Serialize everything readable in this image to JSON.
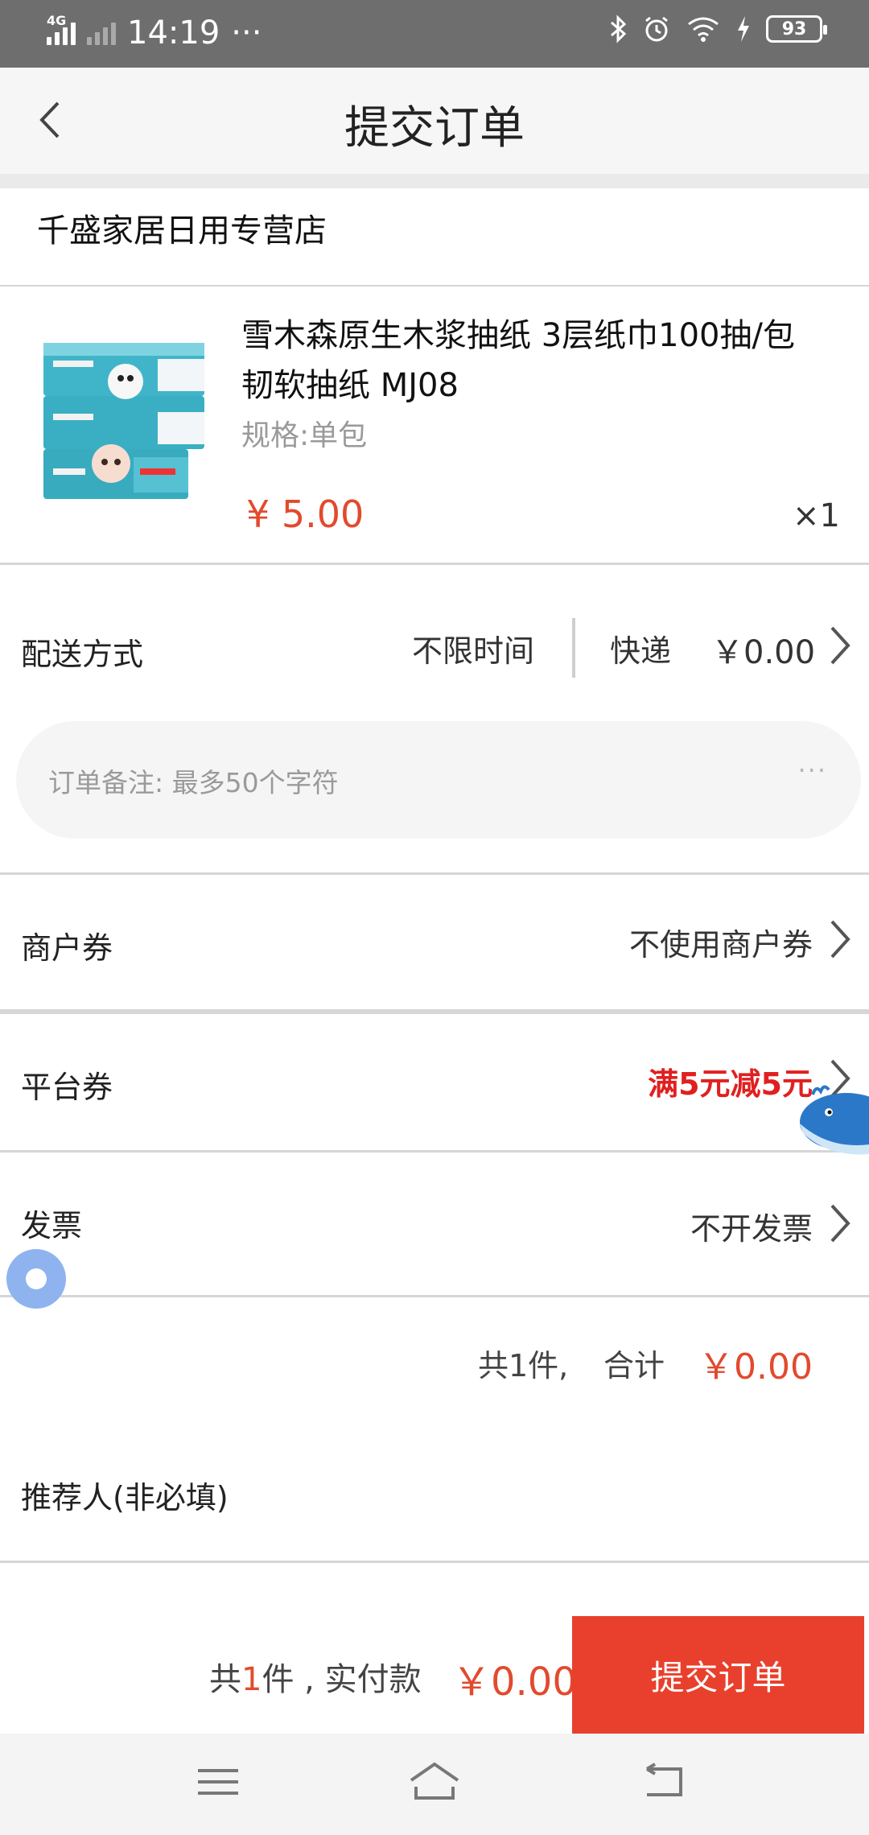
{
  "status_bar": {
    "network": "4G",
    "time": "14:19",
    "more": "···",
    "battery": "93"
  },
  "header": {
    "title": "提交订单"
  },
  "store": {
    "name": "千盛家居日用专营店"
  },
  "product": {
    "name": "雪木森原生木浆抽纸 3层纸巾100抽/包 韧软抽纸 MJ08",
    "spec": "规格:单包",
    "price": "¥ 5.00",
    "qty": "×1"
  },
  "delivery": {
    "label": "配送方式",
    "time": "不限时间",
    "method": "快递",
    "fee": "￥0.00"
  },
  "remark": {
    "placeholder": "订单备注: 最多50个字符",
    "more": "···"
  },
  "merchant_coupon": {
    "label": "商户券",
    "value": "不使用商户券"
  },
  "platform_coupon": {
    "label": "平台券",
    "value": "满5元减5元"
  },
  "invoice": {
    "label": "发票",
    "value": "不开发票"
  },
  "summary": {
    "count": "共1件,",
    "total_label": "合计",
    "total": "￥0.00"
  },
  "referrer": {
    "label": "推荐人(非必填)"
  },
  "bottom_bar": {
    "count_prefix": "共",
    "count_num": "1",
    "count_suffix": "件 , 实付款",
    "pay": "￥0.00",
    "submit": "提交订单"
  },
  "colors": {
    "accent": "#e8402d",
    "price": "#e24a2e",
    "coupon": "#e02020"
  }
}
